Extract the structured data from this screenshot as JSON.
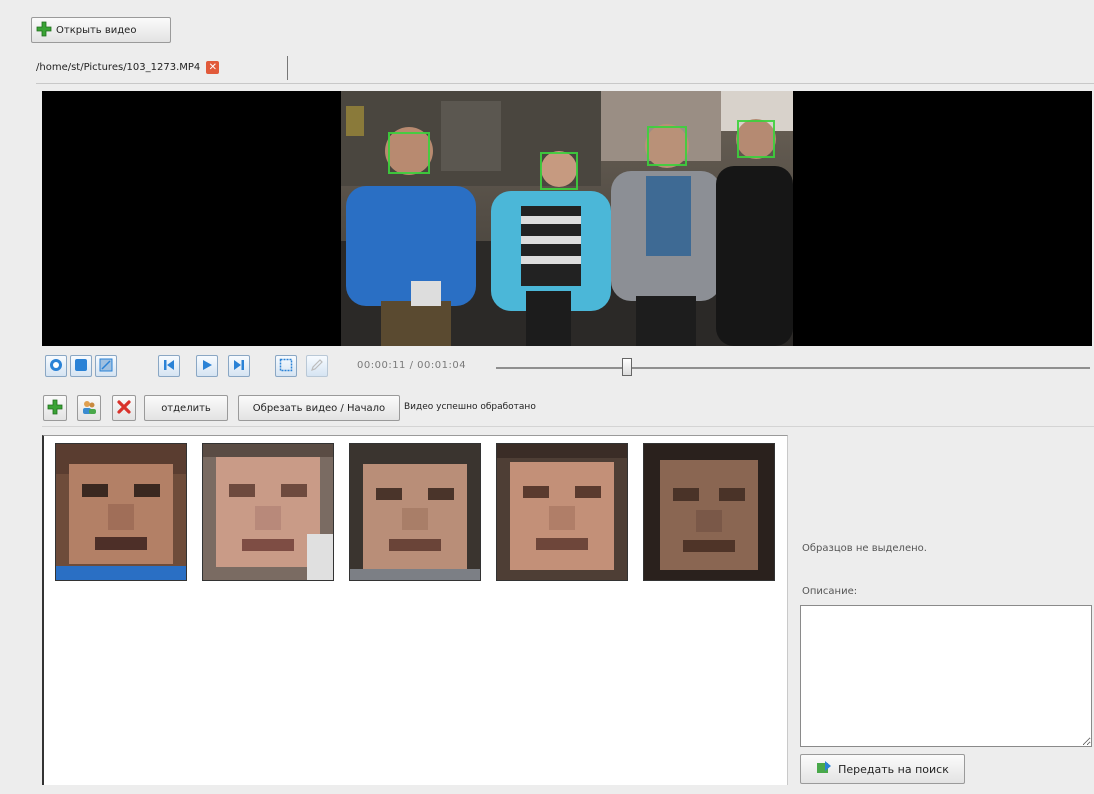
{
  "toolbar": {
    "open_video_label": "Открыть видео"
  },
  "tab": {
    "filename": "/home/st/Pictures/103_1273.MP4",
    "close_glyph": "✕"
  },
  "player": {
    "time_display": "00:00:11 / 00:01:04",
    "seek_position": 0.22
  },
  "actions": {
    "separate_label": "отделить",
    "trim_label": "Обрезать видео / Начало",
    "status_text": "Видео успешно обработано"
  },
  "faces": {
    "count": 5
  },
  "side": {
    "no_samples_text": "Образцов не выделено.",
    "description_label": "Описание:",
    "description_value": "",
    "send_label": "Передать на поиск"
  },
  "colors": {
    "accent": "#2a82d6",
    "add_green": "#3aa335",
    "delete_red": "#d9322b",
    "face_box": "#3cd23c"
  }
}
